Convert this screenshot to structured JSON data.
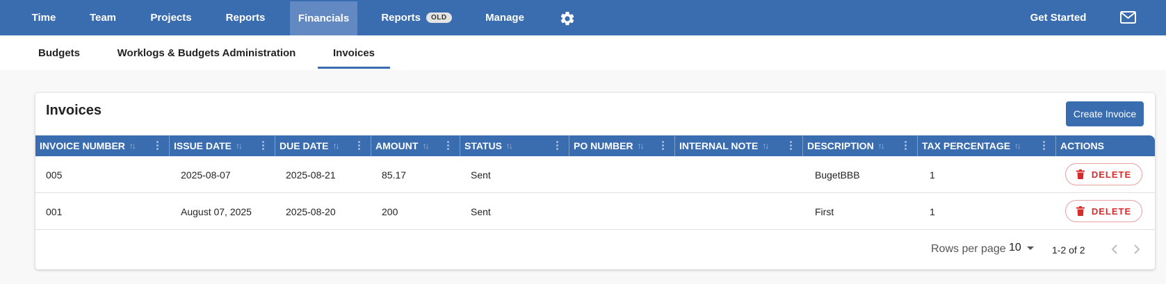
{
  "nav": {
    "items": [
      {
        "label": "Time"
      },
      {
        "label": "Team"
      },
      {
        "label": "Projects"
      },
      {
        "label": "Reports"
      },
      {
        "label": "Financials"
      },
      {
        "label": "Reports",
        "badge": "OLD"
      },
      {
        "label": "Manage"
      }
    ],
    "active_item": "Financials",
    "settings_icon": "gear-icon",
    "get_started": "Get Started",
    "mail_icon": "mail-icon"
  },
  "subtabs": {
    "items": [
      {
        "label": "Budgets"
      },
      {
        "label": "Worklogs & Budgets Administration"
      },
      {
        "label": "Invoices"
      }
    ],
    "active": "Invoices"
  },
  "invoices": {
    "title": "Invoices",
    "create_button": "Create Invoice",
    "columns": [
      "INVOICE NUMBER",
      "ISSUE DATE",
      "DUE DATE",
      "AMOUNT",
      "STATUS",
      "PO NUMBER",
      "INTERNAL NOTE",
      "DESCRIPTION",
      "TAX PERCENTAGE",
      "ACTIONS"
    ],
    "sort_icon": "↑↓",
    "rows": [
      {
        "invoice_number": "005",
        "issue_date": "2025-08-07",
        "due_date": "2025-08-21",
        "amount": "85.17",
        "status": "Sent",
        "po_number": "",
        "internal_note": "",
        "description": "BugetBBB",
        "tax_percentage": "1",
        "action": "DELETE"
      },
      {
        "invoice_number": "001",
        "issue_date": "August 07, 2025",
        "due_date": "2025-08-20",
        "amount": "200",
        "status": "Sent",
        "po_number": "",
        "internal_note": "",
        "description": "First",
        "tax_percentage": "1",
        "action": "DELETE"
      }
    ],
    "footer": {
      "rows_per_page_label": "Rows per page",
      "rows_per_page_value": "10",
      "range": "1-2 of 2"
    }
  },
  "colors": {
    "primary": "#3a6cb0",
    "active_nav": "#6389c3",
    "danger": "#d52b2b"
  }
}
